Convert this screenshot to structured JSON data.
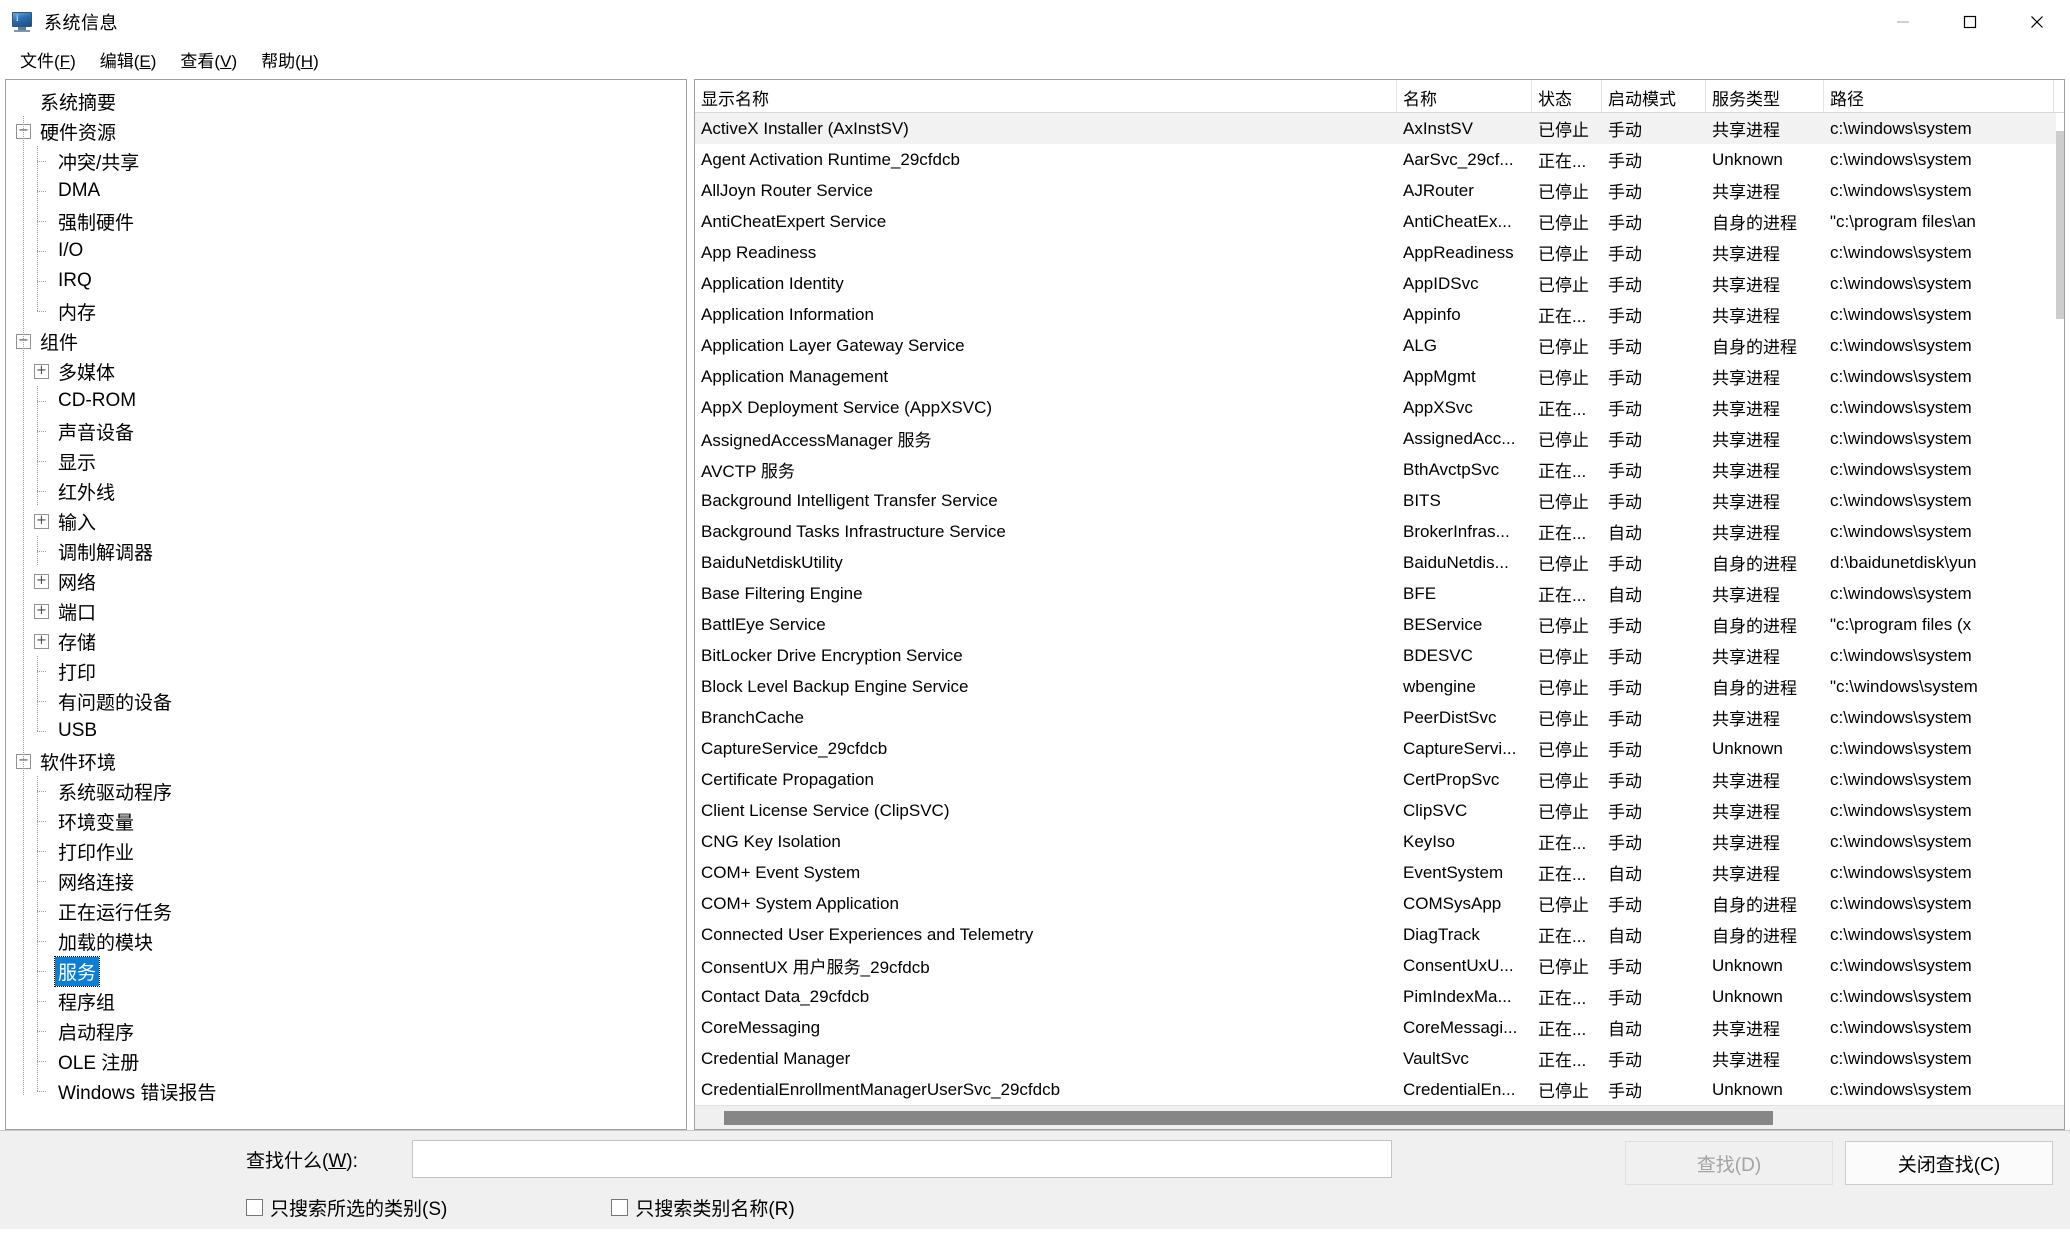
{
  "window": {
    "title": "系统信息",
    "icon": "computer-monitor-icon",
    "minimize_label": "—",
    "maximize_label": "□",
    "close_label": "✕"
  },
  "menubar": [
    {
      "label": "文件",
      "mnemonic": "F"
    },
    {
      "label": "编辑",
      "mnemonic": "E"
    },
    {
      "label": "查看",
      "mnemonic": "V"
    },
    {
      "label": "帮助",
      "mnemonic": "H"
    }
  ],
  "tree": {
    "selected": "服务",
    "nodes": [
      {
        "label": "系统摘要",
        "level": 0,
        "expander": "none"
      },
      {
        "label": "硬件资源",
        "level": 0,
        "expander": "minus"
      },
      {
        "label": "冲突/共享",
        "level": 1,
        "expander": "leaf"
      },
      {
        "label": "DMA",
        "level": 1,
        "expander": "leaf"
      },
      {
        "label": "强制硬件",
        "level": 1,
        "expander": "leaf"
      },
      {
        "label": "I/O",
        "level": 1,
        "expander": "leaf"
      },
      {
        "label": "IRQ",
        "level": 1,
        "expander": "leaf"
      },
      {
        "label": "内存",
        "level": 1,
        "expander": "leaf-last"
      },
      {
        "label": "组件",
        "level": 0,
        "expander": "minus"
      },
      {
        "label": "多媒体",
        "level": 1,
        "expander": "plus"
      },
      {
        "label": "CD-ROM",
        "level": 1,
        "expander": "leaf"
      },
      {
        "label": "声音设备",
        "level": 1,
        "expander": "leaf"
      },
      {
        "label": "显示",
        "level": 1,
        "expander": "leaf"
      },
      {
        "label": "红外线",
        "level": 1,
        "expander": "leaf"
      },
      {
        "label": "输入",
        "level": 1,
        "expander": "plus"
      },
      {
        "label": "调制解调器",
        "level": 1,
        "expander": "leaf"
      },
      {
        "label": "网络",
        "level": 1,
        "expander": "plus"
      },
      {
        "label": "端口",
        "level": 1,
        "expander": "plus"
      },
      {
        "label": "存储",
        "level": 1,
        "expander": "plus"
      },
      {
        "label": "打印",
        "level": 1,
        "expander": "leaf"
      },
      {
        "label": "有问题的设备",
        "level": 1,
        "expander": "leaf"
      },
      {
        "label": "USB",
        "level": 1,
        "expander": "leaf-last"
      },
      {
        "label": "软件环境",
        "level": 0,
        "expander": "minus"
      },
      {
        "label": "系统驱动程序",
        "level": 1,
        "expander": "leaf"
      },
      {
        "label": "环境变量",
        "level": 1,
        "expander": "leaf"
      },
      {
        "label": "打印作业",
        "level": 1,
        "expander": "leaf"
      },
      {
        "label": "网络连接",
        "level": 1,
        "expander": "leaf"
      },
      {
        "label": "正在运行任务",
        "level": 1,
        "expander": "leaf"
      },
      {
        "label": "加载的模块",
        "level": 1,
        "expander": "leaf"
      },
      {
        "label": "服务",
        "level": 1,
        "expander": "leaf"
      },
      {
        "label": "程序组",
        "level": 1,
        "expander": "leaf"
      },
      {
        "label": "启动程序",
        "level": 1,
        "expander": "leaf"
      },
      {
        "label": "OLE 注册",
        "level": 1,
        "expander": "leaf"
      },
      {
        "label": "Windows 错误报告",
        "level": 1,
        "expander": "leaf-last"
      }
    ]
  },
  "list": {
    "columns": [
      "显示名称",
      "名称",
      "状态",
      "启动模式",
      "服务类型",
      "路径"
    ],
    "selected_index": 0,
    "rows": [
      [
        "ActiveX Installer (AxInstSV)",
        "AxInstSV",
        "已停止",
        "手动",
        "共享进程",
        "c:\\windows\\system"
      ],
      [
        "Agent Activation Runtime_29cfdcb",
        "AarSvc_29cf...",
        "正在...",
        "手动",
        "Unknown",
        "c:\\windows\\system"
      ],
      [
        "AllJoyn Router Service",
        "AJRouter",
        "已停止",
        "手动",
        "共享进程",
        "c:\\windows\\system"
      ],
      [
        "AntiCheatExpert Service",
        "AntiCheatEx...",
        "已停止",
        "手动",
        "自身的进程",
        "\"c:\\program files\\an"
      ],
      [
        "App Readiness",
        "AppReadiness",
        "已停止",
        "手动",
        "共享进程",
        "c:\\windows\\system"
      ],
      [
        "Application Identity",
        "AppIDSvc",
        "已停止",
        "手动",
        "共享进程",
        "c:\\windows\\system"
      ],
      [
        "Application Information",
        "Appinfo",
        "正在...",
        "手动",
        "共享进程",
        "c:\\windows\\system"
      ],
      [
        "Application Layer Gateway Service",
        "ALG",
        "已停止",
        "手动",
        "自身的进程",
        "c:\\windows\\system"
      ],
      [
        "Application Management",
        "AppMgmt",
        "已停止",
        "手动",
        "共享进程",
        "c:\\windows\\system"
      ],
      [
        "AppX Deployment Service (AppXSVC)",
        "AppXSvc",
        "正在...",
        "手动",
        "共享进程",
        "c:\\windows\\system"
      ],
      [
        "AssignedAccessManager 服务",
        "AssignedAcc...",
        "已停止",
        "手动",
        "共享进程",
        "c:\\windows\\system"
      ],
      [
        "AVCTP 服务",
        "BthAvctpSvc",
        "正在...",
        "手动",
        "共享进程",
        "c:\\windows\\system"
      ],
      [
        "Background Intelligent Transfer Service",
        "BITS",
        "已停止",
        "手动",
        "共享进程",
        "c:\\windows\\system"
      ],
      [
        "Background Tasks Infrastructure Service",
        "BrokerInfras...",
        "正在...",
        "自动",
        "共享进程",
        "c:\\windows\\system"
      ],
      [
        "BaiduNetdiskUtility",
        "BaiduNetdis...",
        "已停止",
        "手动",
        "自身的进程",
        "d:\\baidunetdisk\\yun"
      ],
      [
        "Base Filtering Engine",
        "BFE",
        "正在...",
        "自动",
        "共享进程",
        "c:\\windows\\system"
      ],
      [
        "BattlEye Service",
        "BEService",
        "已停止",
        "手动",
        "自身的进程",
        "\"c:\\program files (x"
      ],
      [
        "BitLocker Drive Encryption Service",
        "BDESVC",
        "已停止",
        "手动",
        "共享进程",
        "c:\\windows\\system"
      ],
      [
        "Block Level Backup Engine Service",
        "wbengine",
        "已停止",
        "手动",
        "自身的进程",
        "\"c:\\windows\\system"
      ],
      [
        "BranchCache",
        "PeerDistSvc",
        "已停止",
        "手动",
        "共享进程",
        "c:\\windows\\system"
      ],
      [
        "CaptureService_29cfdcb",
        "CaptureServi...",
        "已停止",
        "手动",
        "Unknown",
        "c:\\windows\\system"
      ],
      [
        "Certificate Propagation",
        "CertPropSvc",
        "已停止",
        "手动",
        "共享进程",
        "c:\\windows\\system"
      ],
      [
        "Client License Service (ClipSVC)",
        "ClipSVC",
        "已停止",
        "手动",
        "共享进程",
        "c:\\windows\\system"
      ],
      [
        "CNG Key Isolation",
        "KeyIso",
        "正在...",
        "手动",
        "共享进程",
        "c:\\windows\\system"
      ],
      [
        "COM+ Event System",
        "EventSystem",
        "正在...",
        "自动",
        "共享进程",
        "c:\\windows\\system"
      ],
      [
        "COM+ System Application",
        "COMSysApp",
        "已停止",
        "手动",
        "自身的进程",
        "c:\\windows\\system"
      ],
      [
        "Connected User Experiences and Telemetry",
        "DiagTrack",
        "正在...",
        "自动",
        "自身的进程",
        "c:\\windows\\system"
      ],
      [
        "ConsentUX 用户服务_29cfdcb",
        "ConsentUxU...",
        "已停止",
        "手动",
        "Unknown",
        "c:\\windows\\system"
      ],
      [
        "Contact Data_29cfdcb",
        "PimIndexMa...",
        "正在...",
        "手动",
        "Unknown",
        "c:\\windows\\system"
      ],
      [
        "CoreMessaging",
        "CoreMessagi...",
        "正在...",
        "自动",
        "共享进程",
        "c:\\windows\\system"
      ],
      [
        "Credential Manager",
        "VaultSvc",
        "正在...",
        "手动",
        "共享进程",
        "c:\\windows\\system"
      ],
      [
        "CredentialEnrollmentManagerUserSvc_29cfdcb",
        "CredentialEn...",
        "已停止",
        "手动",
        "Unknown",
        "c:\\windows\\system"
      ]
    ]
  },
  "find": {
    "label": "查找什么(W):",
    "label_mnemonic": "W",
    "input_value": "",
    "input_placeholder": "",
    "find_button": "查找(D)",
    "find_button_enabled": false,
    "close_button": "关闭查找(C)",
    "checkbox_selected_category": "只搜索所选的类别(S)",
    "checkbox_selected_category_checked": false,
    "checkbox_category_name": "只搜索类别名称(R)",
    "checkbox_category_name_checked": false
  },
  "colors": {
    "selection_blue": "#0b7fd4",
    "row_selected_gray": "#f2f2f2",
    "scrollbar_thumb": "#868686",
    "panel_bg": "#f0f0f0"
  }
}
